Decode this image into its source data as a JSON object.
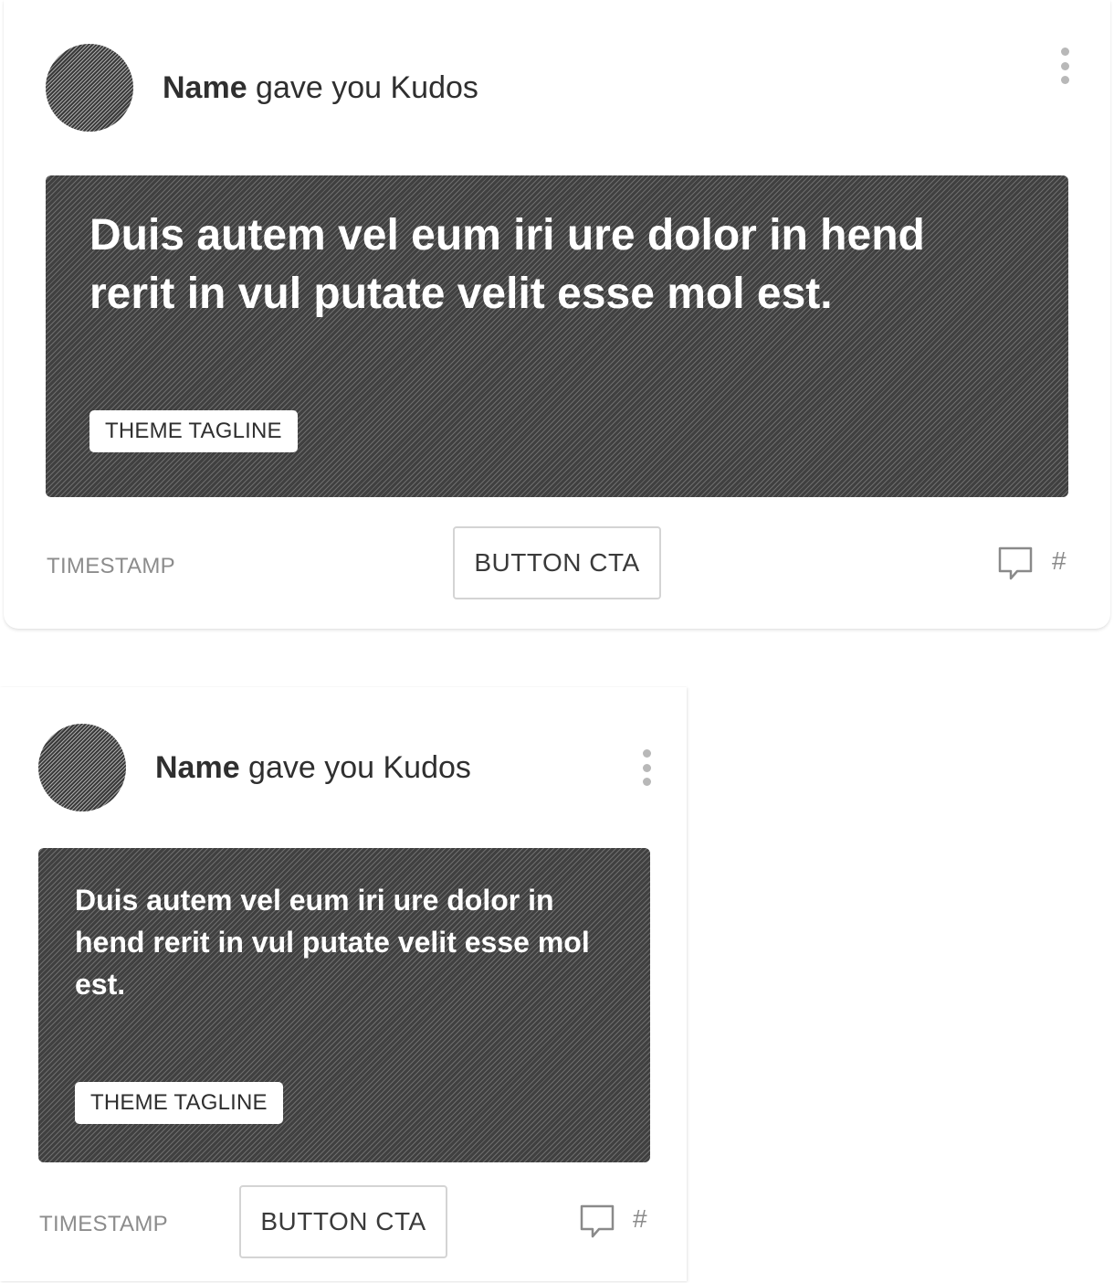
{
  "cards": [
    {
      "author_name": "Name",
      "action_text": " gave you Kudos",
      "hero_text": "Duis autem vel eum iri ure dolor in hend rerit in vul putate velit esse mol est.",
      "tagline": "THEME TAGLINE",
      "timestamp": "TIMESTAMP",
      "cta_label": "BUTTON CTA",
      "comment_count": "#"
    },
    {
      "author_name": "Name",
      "action_text": " gave you Kudos",
      "hero_text": "Duis autem vel eum iri ure dolor in hend rerit in vul putate velit esse mol est.",
      "tagline": "THEME TAGLINE",
      "timestamp": "TIMESTAMP",
      "cta_label": "BUTTON CTA",
      "comment_count": "#"
    }
  ],
  "icons": {
    "more": "vertical-ellipsis-icon",
    "comment": "speech-bubble-icon"
  },
  "colors": {
    "hero_background": "#404040",
    "text": "#2f2f2f",
    "muted": "#8c8c8c",
    "border": "#d4d4d4"
  }
}
